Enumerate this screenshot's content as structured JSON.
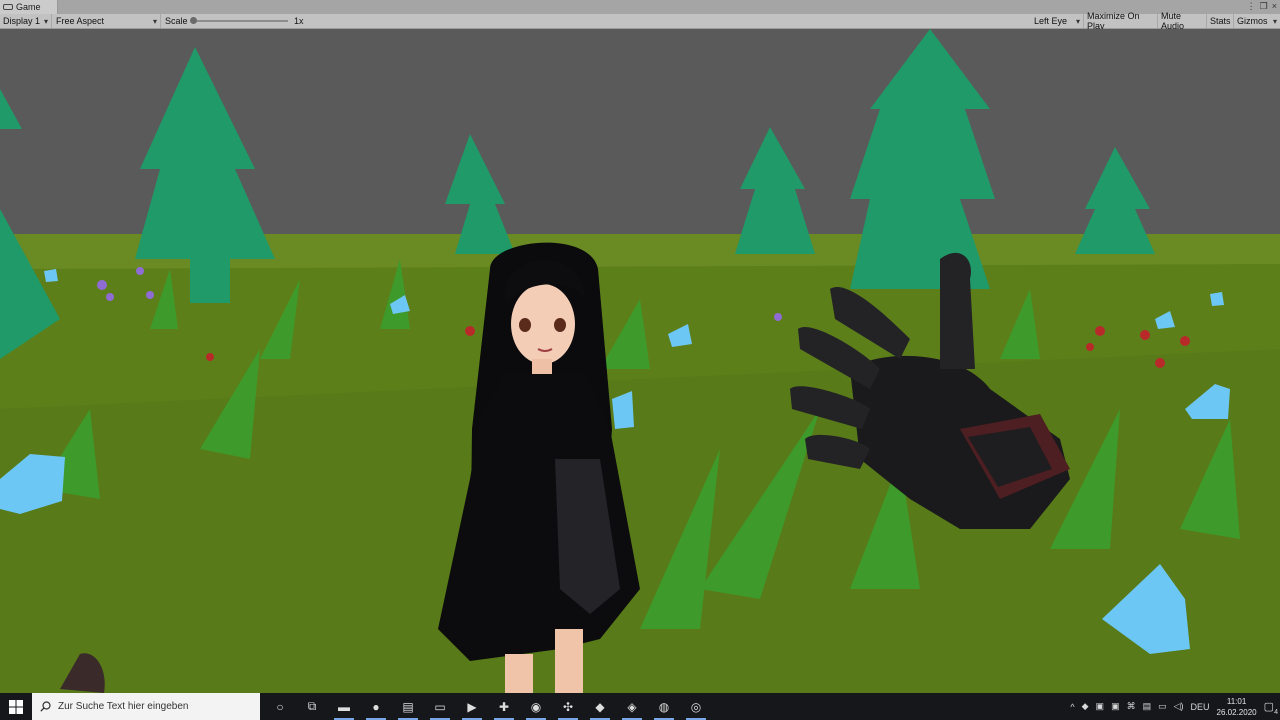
{
  "game_tab": {
    "label": "Game",
    "icon": "game-controller-icon"
  },
  "window_controls": {
    "menu_glyph": "⋮",
    "maximize_glyph": "❐",
    "close_glyph": "×"
  },
  "toolbar": {
    "display": "Display 1",
    "aspect": "Free Aspect",
    "scale_label": "Scale",
    "scale_value": "1x",
    "scale_slider_fraction": 0.0,
    "eye": "Left Eye",
    "maximize": "Maximize On Play",
    "mute": "Mute Audio",
    "stats": "Stats",
    "gizmos": "Gizmos"
  },
  "scene": {
    "sky_color": "#5a5a5a",
    "ground_color": "#5d7f1a",
    "tree_color": "#1f9a68",
    "crystal_color": "#6cc7f4"
  },
  "taskbar": {
    "start_icon": "windows-logo-icon",
    "search_placeholder": "Zur Suche Text hier eingeben",
    "apps": [
      {
        "name": "cortana-icon",
        "glyph": "○"
      },
      {
        "name": "task-view-icon",
        "glyph": "⧉"
      },
      {
        "name": "file-explorer-icon",
        "glyph": "▬"
      },
      {
        "name": "chrome-icon",
        "glyph": "●"
      },
      {
        "name": "notepad-icon",
        "glyph": "▤"
      },
      {
        "name": "terminal-icon",
        "glyph": "▭"
      },
      {
        "name": "media-player-icon",
        "glyph": "▶"
      },
      {
        "name": "app-icon-green",
        "glyph": "✚"
      },
      {
        "name": "firefox-icon",
        "glyph": "◉"
      },
      {
        "name": "tool-icon",
        "glyph": "✣"
      },
      {
        "name": "visual-studio-icon",
        "glyph": "◆"
      },
      {
        "name": "unity-icon",
        "glyph": "◈"
      },
      {
        "name": "steam-icon",
        "glyph": "◍"
      },
      {
        "name": "obs-icon",
        "glyph": "◎"
      }
    ],
    "tray": {
      "language": "DEU",
      "time": "11:01",
      "date": "26.02.2020",
      "notification_count": "4"
    }
  }
}
